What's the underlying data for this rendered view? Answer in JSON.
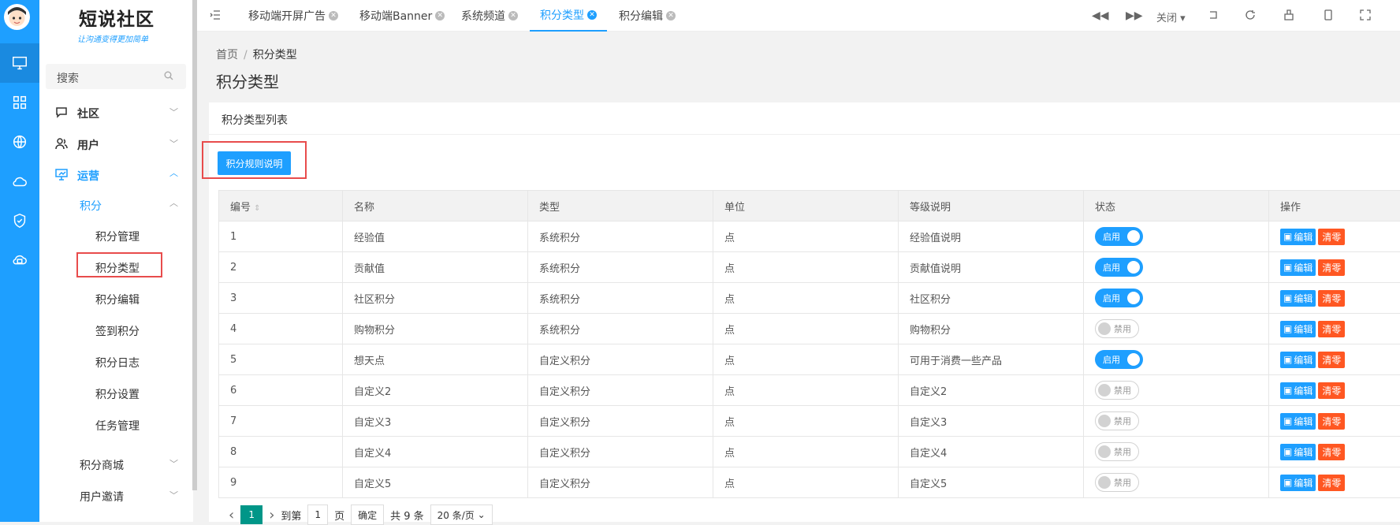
{
  "app": {
    "brand": "短说社区",
    "slogan": "让沟通变得更加简单"
  },
  "search": {
    "placeholder": "搜索"
  },
  "menu": {
    "community": "社区",
    "users": "用户",
    "operations": "运营",
    "points": "积分",
    "points_items": [
      "积分管理",
      "积分类型",
      "积分编辑",
      "签到积分",
      "积分日志",
      "积分设置",
      "任务管理"
    ],
    "points_mall": "积分商城",
    "invite": "用户邀请"
  },
  "tabs": [
    "移动端开屏广告",
    "移动端Banner",
    "系统频道",
    "积分类型",
    "积分编辑"
  ],
  "toolbar": {
    "close": "关闭"
  },
  "breadcrumb": {
    "home": "首页",
    "current": "积分类型"
  },
  "page_title": "积分类型",
  "card_title": "积分类型列表",
  "rule_button": "积分规则说明",
  "table": {
    "headers": [
      "编号",
      "名称",
      "类型",
      "单位",
      "等级说明",
      "状态",
      "操作"
    ],
    "rows": [
      [
        "1",
        "经验值",
        "系统积分",
        "点",
        "经验值说明",
        "启用"
      ],
      [
        "2",
        "贡献值",
        "系统积分",
        "点",
        "贡献值说明",
        "启用"
      ],
      [
        "3",
        "社区积分",
        "系统积分",
        "点",
        "社区积分",
        "启用"
      ],
      [
        "4",
        "购物积分",
        "系统积分",
        "点",
        "购物积分",
        "禁用"
      ],
      [
        "5",
        "想天点",
        "自定义积分",
        "点",
        "可用于消费一些产品",
        "启用"
      ],
      [
        "6",
        "自定义2",
        "自定义积分",
        "点",
        "自定义2",
        "禁用"
      ],
      [
        "7",
        "自定义3",
        "自定义积分",
        "点",
        "自定义3",
        "禁用"
      ],
      [
        "8",
        "自定义4",
        "自定义积分",
        "点",
        "自定义4",
        "禁用"
      ],
      [
        "9",
        "自定义5",
        "自定义积分",
        "点",
        "自定义5",
        "禁用"
      ]
    ],
    "edit_label": "编辑",
    "clear_label": "清零"
  },
  "pager": {
    "current": "1",
    "goto": "到第",
    "page_input": "1",
    "page_unit": "页",
    "confirm": "确定",
    "total": "共 9 条",
    "per_page": "20 条/页"
  },
  "colors": {
    "primary": "#1e9fff",
    "danger": "#ff5722",
    "highlight": "#e84c4c",
    "pager": "#009688"
  }
}
